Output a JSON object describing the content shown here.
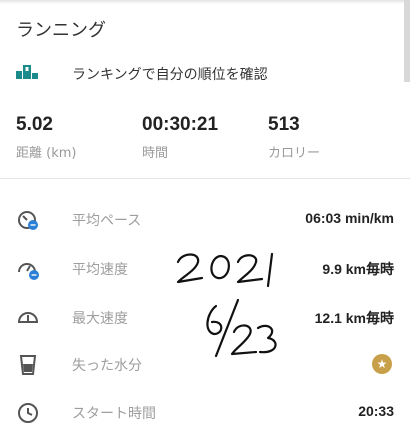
{
  "header": {
    "title": "ランニング"
  },
  "ranking": {
    "text": "ランキングで自分の順位を確認",
    "icon": "podium-icon"
  },
  "stats": [
    {
      "value": "5.02",
      "label": "距離 (km)"
    },
    {
      "value": "00:30:21",
      "label": "時間"
    },
    {
      "value": "513",
      "label": "カロリー"
    }
  ],
  "details": [
    {
      "icon": "pace-gauge-icon",
      "label": "平均ペース",
      "value": "06:03 min/km"
    },
    {
      "icon": "speed-gauge-icon",
      "label": "平均速度",
      "value": "9.9 km毎時"
    },
    {
      "icon": "max-speed-gauge-icon",
      "label": "最大速度",
      "value": "12.1 km毎時"
    },
    {
      "icon": "water-glass-icon",
      "label": "失った水分",
      "value": ""
    },
    {
      "icon": "clock-icon",
      "label": "スタート時間",
      "value": "20:33"
    }
  ],
  "premium_badge": {
    "icon": "star-icon",
    "color": "#c9a04a"
  },
  "handwritten_note": {
    "line1": "2021",
    "line2": "6/23"
  },
  "colors": {
    "accent": "#1a8a8a",
    "icon_blue": "#2a7fd6",
    "label_gray": "#9e9e9e"
  }
}
